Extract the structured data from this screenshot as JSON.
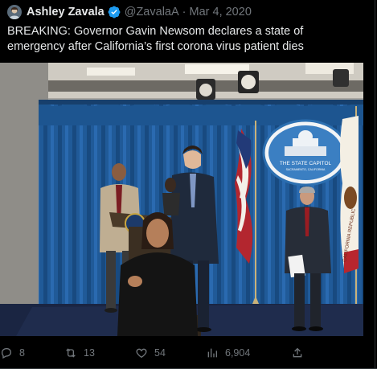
{
  "tweet": {
    "author_name": "Ashley Zavala",
    "handle": "@ZavalaA",
    "separator": "·",
    "date": "Mar 4, 2020",
    "text": "BREAKING: Governor Gavin Newsom declares a state of emergency after California’s first corona virus patient dies",
    "media": {
      "seal_title": "THE STATE CAPITOL",
      "seal_subtitle": "SACRAMENTO, CALIFORNIA",
      "flag_text": "CALIFORNIA REPUBLIC"
    },
    "actions": {
      "replies": "8",
      "retweets": "13",
      "likes": "54",
      "views": "6,904"
    },
    "colors": {
      "accent": "#1d9bf0",
      "muted": "#71767b",
      "text": "#e7e9ea",
      "background": "#000000"
    },
    "icons": [
      "verified-badge-icon",
      "reply-icon",
      "retweet-icon",
      "like-icon",
      "views-icon",
      "share-icon"
    ]
  }
}
